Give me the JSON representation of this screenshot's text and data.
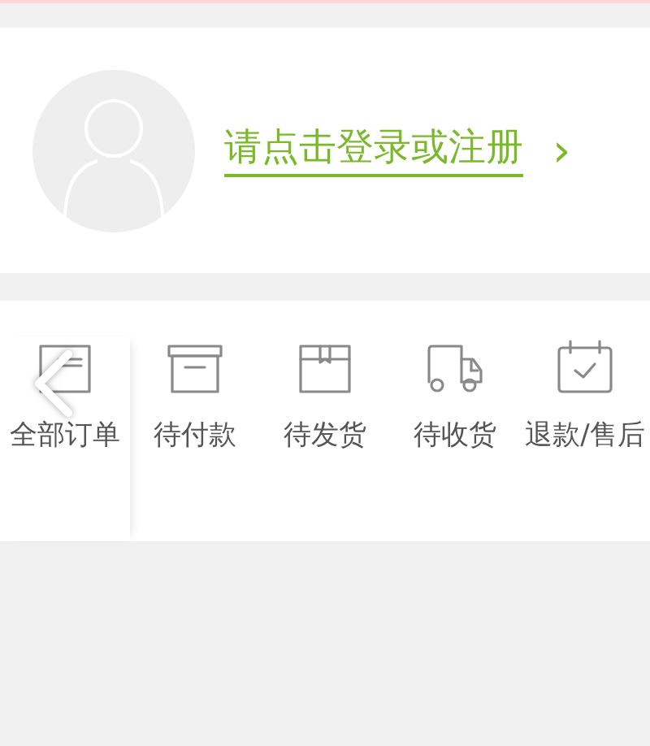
{
  "profile": {
    "login_link": "请点击登录或注册",
    "arrow": "›"
  },
  "orders": [
    {
      "label": "全部订单",
      "kind": "list"
    },
    {
      "label": "待付款",
      "kind": "box"
    },
    {
      "label": "待发货",
      "kind": "package"
    },
    {
      "label": "待收货",
      "kind": "truck"
    },
    {
      "label": "退款/售后",
      "kind": "calendar"
    }
  ]
}
